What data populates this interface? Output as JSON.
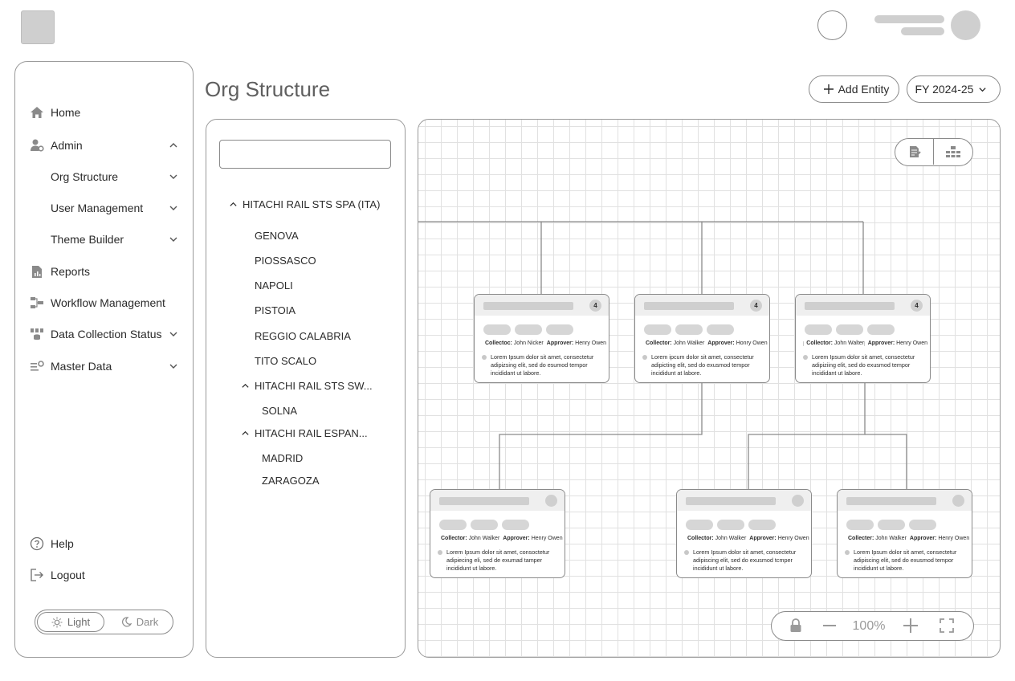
{
  "page": {
    "title": "Org Structure"
  },
  "header": {
    "add_entity_label": "Add Entity",
    "fiscal_year": "FY 2024-25"
  },
  "sidebar": {
    "items": [
      {
        "label": "Home",
        "icon": "home-icon",
        "expanded": null
      },
      {
        "label": "Admin",
        "icon": "admin-icon",
        "expanded": true
      },
      {
        "label": "Org Structure",
        "icon": null,
        "expanded": false
      },
      {
        "label": "User Management",
        "icon": null,
        "expanded": false
      },
      {
        "label": "Theme Builder",
        "icon": null,
        "expanded": false
      },
      {
        "label": "Reports",
        "icon": "reports-icon",
        "expanded": null
      },
      {
        "label": "Workflow Management",
        "icon": "workflow-icon",
        "expanded": null
      },
      {
        "label": "Data Collection Status",
        "icon": "data-collection-icon",
        "expanded": false
      },
      {
        "label": "Master Data",
        "icon": "master-data-icon",
        "expanded": false
      }
    ],
    "help_label": "Help",
    "logout_label": "Logout",
    "theme": {
      "light_label": "Light",
      "dark_label": "Dark",
      "selected": "Light"
    }
  },
  "tree": {
    "search_value": "",
    "nodes": [
      {
        "label": "HITACHI RAIL STS SPA (ITA)",
        "level": 0,
        "expanded": true
      },
      {
        "label": "GENOVA",
        "level": 1
      },
      {
        "label": "PIOSSASCO",
        "level": 1
      },
      {
        "label": "NAPOLI",
        "level": 1
      },
      {
        "label": "PISTOIA",
        "level": 1
      },
      {
        "label": "REGGIO CALABRIA",
        "level": 1
      },
      {
        "label": "TITO SCALO",
        "level": 1
      },
      {
        "label": "HITACHI RAIL STS SW...",
        "level": 1,
        "expanded": true
      },
      {
        "label": "SOLNA",
        "level": 2
      },
      {
        "label": "HITACHI RAIL ESPAN...",
        "level": 1,
        "expanded": true
      },
      {
        "label": "MADRID",
        "level": 2
      },
      {
        "label": "ZARAGOZA",
        "level": 2
      }
    ]
  },
  "canvas": {
    "cards": [
      {
        "badge": "4",
        "collector_label": "Collectoc:",
        "collector": "John Nicker",
        "approver_label": "Approver:",
        "approver": "Henry Owen",
        "description": "Lorem Ipsum dolor sit amet, consectetur adipizsing elit, sed do esumod tempor incididant ut labore."
      },
      {
        "badge": "4",
        "collector_label": "Collector:",
        "collector": "John Walker",
        "approver_label": "Approver:",
        "approver": "Honry Owen",
        "description": "Lorem ipcum dolor sit amet, consectetur adipicting elit, sed do exusmod tempor incididunt at labore."
      },
      {
        "badge": "4",
        "collector_label": "Collector:",
        "collector": "John Walter",
        "approver_label": "Approver:",
        "approver": "Henry Owen",
        "description": "Lorem Ipsum dolor sit amet, consectetur adipiziing elit, sed do exusmod tempor incididant ut labore."
      },
      {
        "badge": "",
        "collector_label": "Collector:",
        "collector": "John Walker",
        "approver_label": "Approver:",
        "approver": "Henry Owen",
        "description": "Lorem Ipsum dolor sit amet, consoctetur adipiecing eli, sed de exumad tamper incididunt ut labore."
      },
      {
        "badge": "",
        "collector_label": "Collector:",
        "collector": "John Walker",
        "approver_label": "Approver:",
        "approver": "Henry Owen",
        "description": "Lorem Ipsum dolor sit amet, consectetur adipiscing elit, sed do exusmod tcmper incididunt ut labore."
      },
      {
        "badge": "",
        "collector_label": "Collecter:",
        "collector": "John Walker",
        "approver_label": "Approver:",
        "approver": "Henry Owen",
        "description": "Lorem Ipsum dolor sit amet, consectetur adipiscing elit, sed do exusmod tempor incididunt ut labore."
      }
    ],
    "zoom": "100%"
  }
}
